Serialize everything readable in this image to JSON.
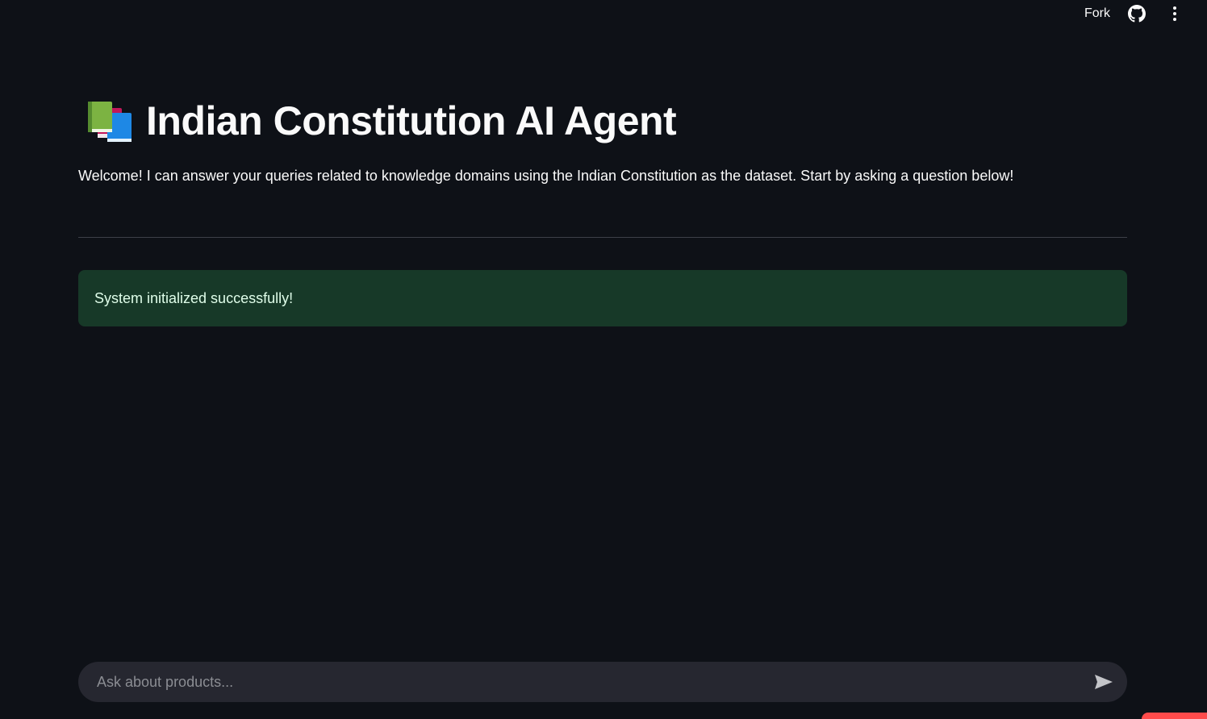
{
  "toolbar": {
    "fork_label": "Fork",
    "github_icon": "github-icon",
    "menu_icon": "more-vertical-icon"
  },
  "header": {
    "icon": "books-icon",
    "title": "Indian Constitution AI Agent",
    "subtitle": "Welcome! I can answer your queries related to knowledge domains using the Indian Constitution as the dataset. Start by asking a question below!"
  },
  "status": {
    "message": "System initialized successfully!",
    "type": "success"
  },
  "chat": {
    "placeholder": "Ask about products...",
    "value": "",
    "send_icon": "send-icon"
  },
  "colors": {
    "background": "#0e1117",
    "success_bg": "#173928",
    "success_text": "#dffde9",
    "input_bg": "#262730",
    "accent": "#ff4b4b"
  }
}
